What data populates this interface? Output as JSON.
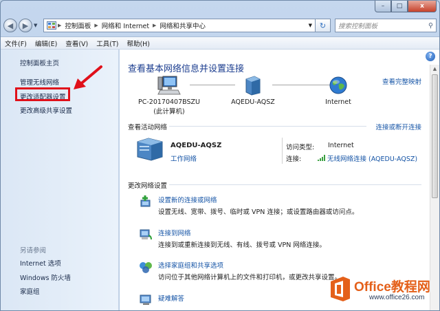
{
  "window_controls": {
    "minimize": "–",
    "maximize": "□",
    "close": "x"
  },
  "address_bar": {
    "crumbs": [
      "控制面板",
      "网络和 Internet",
      "网络和共享中心"
    ],
    "search_placeholder": "搜索控制面板"
  },
  "menu": [
    "文件(F)",
    "编辑(E)",
    "查看(V)",
    "工具(T)",
    "帮助(H)"
  ],
  "left_pane": {
    "home": "控制面板主页",
    "links": [
      "管理无线网络",
      "更改适配器设置",
      "更改高级共享设置"
    ],
    "see_also_title": "另请参阅",
    "see_also": [
      "Internet 选项",
      "Windows 防火墙",
      "家庭组"
    ]
  },
  "main": {
    "title": "查看基本网络信息并设置连接",
    "view_full_map": "查看完整映射",
    "nodes": [
      {
        "label": "PC-20170407BSZU",
        "sub": "(此计算机)",
        "icon": "computer-icon"
      },
      {
        "label": "AQEDU-AQSZ",
        "sub": "",
        "icon": "network-icon"
      },
      {
        "label": "Internet",
        "sub": "",
        "icon": "globe-icon"
      }
    ],
    "active_title": "查看活动网络",
    "connect_disconnect": "连接或断开连接",
    "active_network": {
      "name": "AQEDU-AQSZ",
      "type": "工作网络",
      "access_type_label": "访问类型:",
      "access_type_value": "Internet",
      "connections_label": "连接:",
      "connections_value": "无线网络连接 (AQEDU-AQSZ)"
    },
    "change_title": "更改网络设置",
    "tasks": [
      {
        "link": "设置新的连接或网络",
        "desc": "设置无线、宽带、拨号、临时或 VPN 连接；或设置路由器或访问点。"
      },
      {
        "link": "连接到网络",
        "desc": "连接到或重新连接到无线、有线、拨号或 VPN 网络连接。"
      },
      {
        "link": "选择家庭组和共享选项",
        "desc": "访问位于其他网络计算机上的文件和打印机，或更改共享设置。"
      },
      {
        "link": "疑难解答",
        "desc": ""
      }
    ]
  },
  "watermark": {
    "brand": "Office教程网",
    "url": "www.office26.com"
  },
  "colors": {
    "link": "#1554a6",
    "title": "#1b3d8f",
    "highlight": "#e0101a",
    "brand": "#e4601a"
  }
}
